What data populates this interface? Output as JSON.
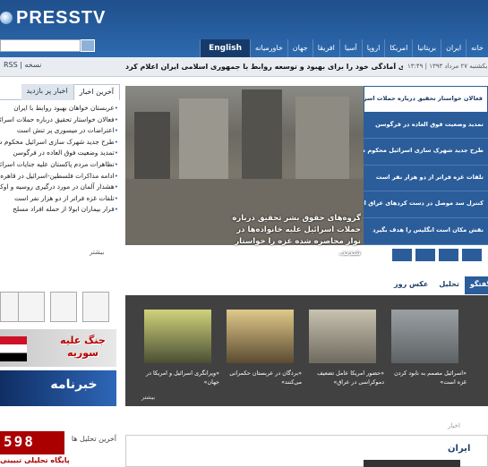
{
  "brand": {
    "logo_text": "PRESSTV"
  },
  "nav": {
    "items": [
      "خانه",
      "ایران",
      "بریتانیا",
      "امریکا",
      "اروپا",
      "آسیا",
      "افریقا",
      "جهان",
      "خاورمیانه",
      "English"
    ]
  },
  "ticker": {
    "rss": "RSS | نسخه",
    "date": "یکشنبه ۲۷ مرداد ۱۳۹۳ | ۱۳:۴۹",
    "headline": "عربستان سعودی آمادگی خود را برای بهبود و توسعه روابط با جمهوری اسلامی ایران اعلام کرد."
  },
  "news_tabs": {
    "latest": "آخرین اخبار",
    "more": "اخبار پر بازدید"
  },
  "latest_news": [
    "عربستان خواهان بهبود روابط با ایران",
    "فعالان خواستار تحقیق درباره حملات اسرائیل",
    "اعتراضات در میسوری پر تنش است",
    "طرح جدید شهرک سازی اسرائیل محکوم شد",
    "تمدید وضعیت فوق العاده در فرگوسن",
    "تظاهرات مردم پاکستان علیه جنایات اسرائیل",
    "ادامه مذاکرات فلسطین-اسرائیل در قاهره",
    "هشدار آلمان در مورد درگیری روسیه و اوکراین",
    "تلفات غزه فراتر از دو هزار نفر است",
    "فرار بیماران ابولا از حمله افراد مسلح"
  ],
  "more_news_label": "بیشتر",
  "feature": {
    "caption": "گروه‌های حقوق بشر تحقیق درباره حملات اسرائیل علیه خانواده‌ها در نوار محاصره شده غزه را خواستار شدند."
  },
  "headlines": [
    "فعالان خواستار تحقیق درباره حملات اسرائیل",
    "تمدید وضعیت فوق العاده در فرگوسن",
    "طرح جدید شهرک سازی اسرائیل محکوم شد",
    "تلفات غزه فراتر از دو هزار نفر است",
    "کنترل سد موصل در دست کردهای عراق است",
    "نقش مکان است انگلیس را هدف بگیرد"
  ],
  "banners": {
    "syria": "جنگ علیه سوریه",
    "news": "خبرنامه"
  },
  "media_tabs": [
    "گفتگو",
    "تحلیل",
    "عکس روز"
  ],
  "media": [
    {
      "caption": "«اسرائیل مصمم به نابود کردن غزه است»"
    },
    {
      "caption": "«حضور امریکا عامل تضعیف دموکراسی در عراق»"
    },
    {
      "caption": "«بردگان در عربستان حکمرانی می‌کنند»"
    },
    {
      "caption": "«ویرانگری اسرائیل و امریکا در جهان»"
    }
  ],
  "media_more": "بیشتر",
  "lower": {
    "analysis_head": "آخرین تحلیل ها",
    "news_label": "اخبار",
    "iran_title": "ایران",
    "logo_598_number": "598",
    "logo_598_sub": "پایگاه تحلیلی تبیینی"
  },
  "colors": {
    "header": "#2e6bb0",
    "headline_panel": "#2b5d9a",
    "media_panel": "#414141",
    "syria_red": "#b00000"
  }
}
